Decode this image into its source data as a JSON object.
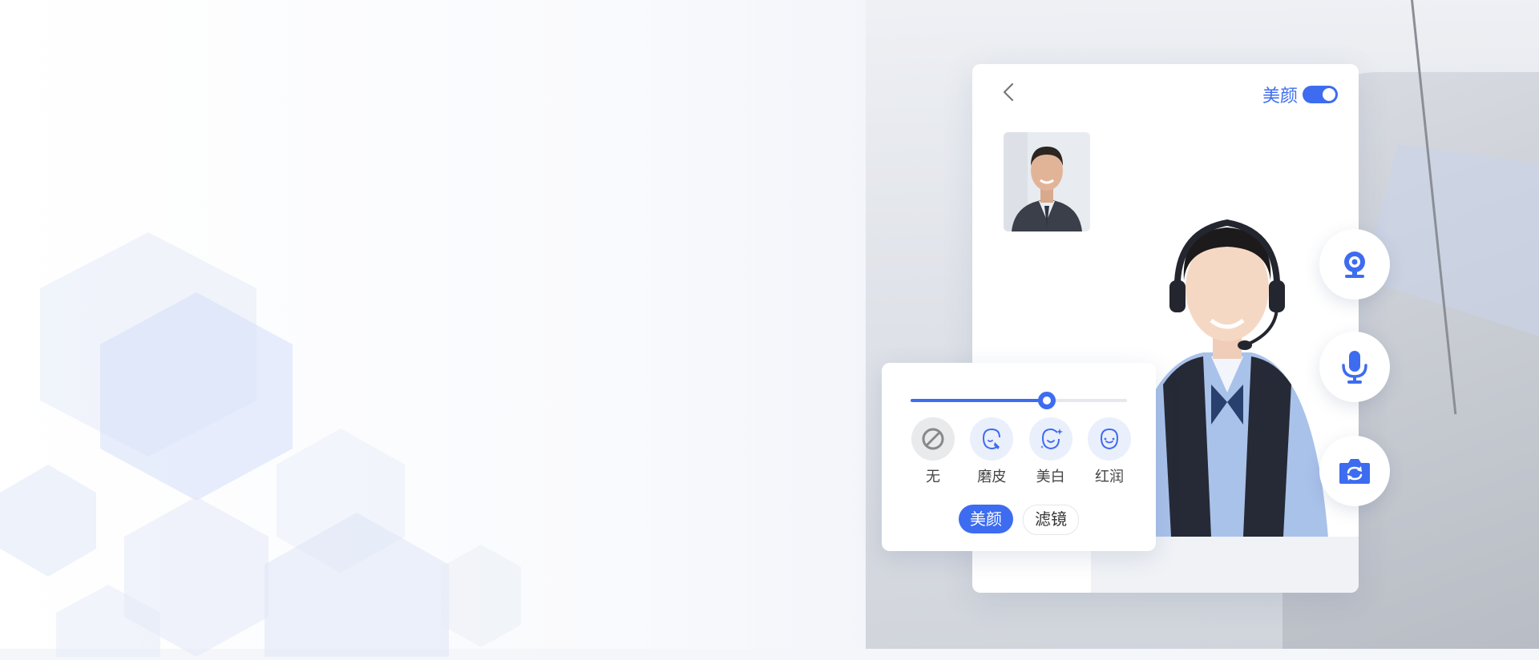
{
  "header": {
    "beauty_label": "美颜",
    "beauty_enabled": true
  },
  "beauty_panel": {
    "slider_level": 0.63,
    "options": [
      {
        "label": "无",
        "icon": "none-icon"
      },
      {
        "label": "磨皮",
        "icon": "smooth-skin-icon"
      },
      {
        "label": "美白",
        "icon": "whiten-icon"
      },
      {
        "label": "红润",
        "icon": "rosy-icon"
      }
    ],
    "tabs": [
      {
        "label": "美颜",
        "active": true
      },
      {
        "label": "滤镜",
        "active": false
      }
    ]
  },
  "side_controls": [
    {
      "icon": "webcam-icon"
    },
    {
      "icon": "microphone-icon"
    },
    {
      "icon": "switch-camera-icon"
    }
  ],
  "colors": {
    "accent": "#3d6cf0",
    "panel_bg": "#ffffff",
    "option_bg": "#eaeffc"
  }
}
